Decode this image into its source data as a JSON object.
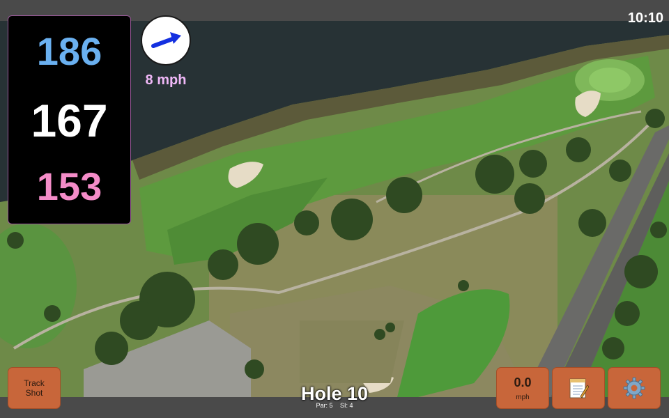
{
  "status_bar": {
    "time": "10:10"
  },
  "distances": {
    "back": "186",
    "middle": "167",
    "front": "153",
    "colors": {
      "back": "#6ab0f0",
      "middle": "#ffffff",
      "front": "#f48cc8"
    }
  },
  "wind": {
    "speed": "8 mph",
    "direction_icon": "arrow-east-northeast-icon",
    "arrow_color": "#1430e0",
    "label_color": "#f0b8f8"
  },
  "hole": {
    "title": "Hole 10",
    "par": "Par: 5",
    "stroke_index": "SI: 4"
  },
  "buttons": {
    "track_shot_line1": "Track",
    "track_shot_line2": "Shot",
    "speed_value": "0.0",
    "speed_unit": "mph",
    "notes_icon": "notepad-icon",
    "settings_icon": "gear-icon"
  },
  "colors": {
    "button": "#c8663a",
    "bar": "#4a4a4a"
  }
}
